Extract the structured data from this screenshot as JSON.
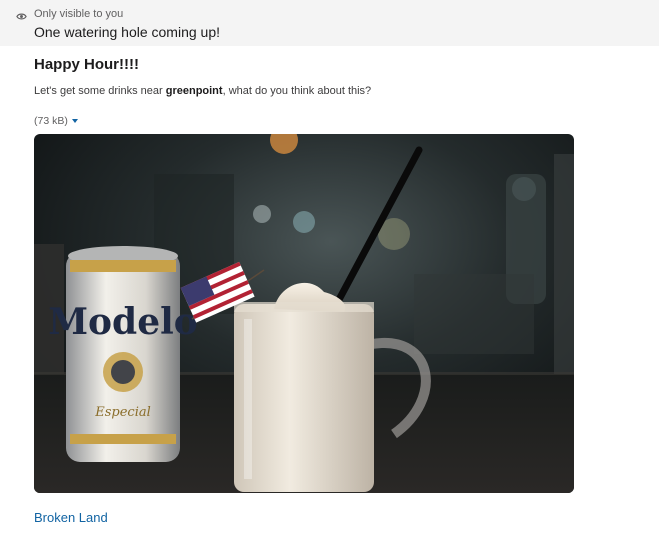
{
  "ephemeral": {
    "icon": "eye-icon",
    "note": "Only visible to you",
    "message": "One watering hole coming up!"
  },
  "post": {
    "title": "Happy Hour!!!!",
    "body_prefix": "Let's get some drinks near ",
    "body_location": "greenpoint",
    "body_suffix": ", what do you think about this?"
  },
  "attachment": {
    "size_label": "(73 kB)",
    "caret_icon": "caret-down-icon",
    "image_description_alt": "",
    "can_brand": "Modelo",
    "can_subtext": "Especial"
  },
  "link": {
    "label": "Broken Land"
  },
  "colors": {
    "link": "#1264a3",
    "banner_bg": "#f4f4f4"
  }
}
